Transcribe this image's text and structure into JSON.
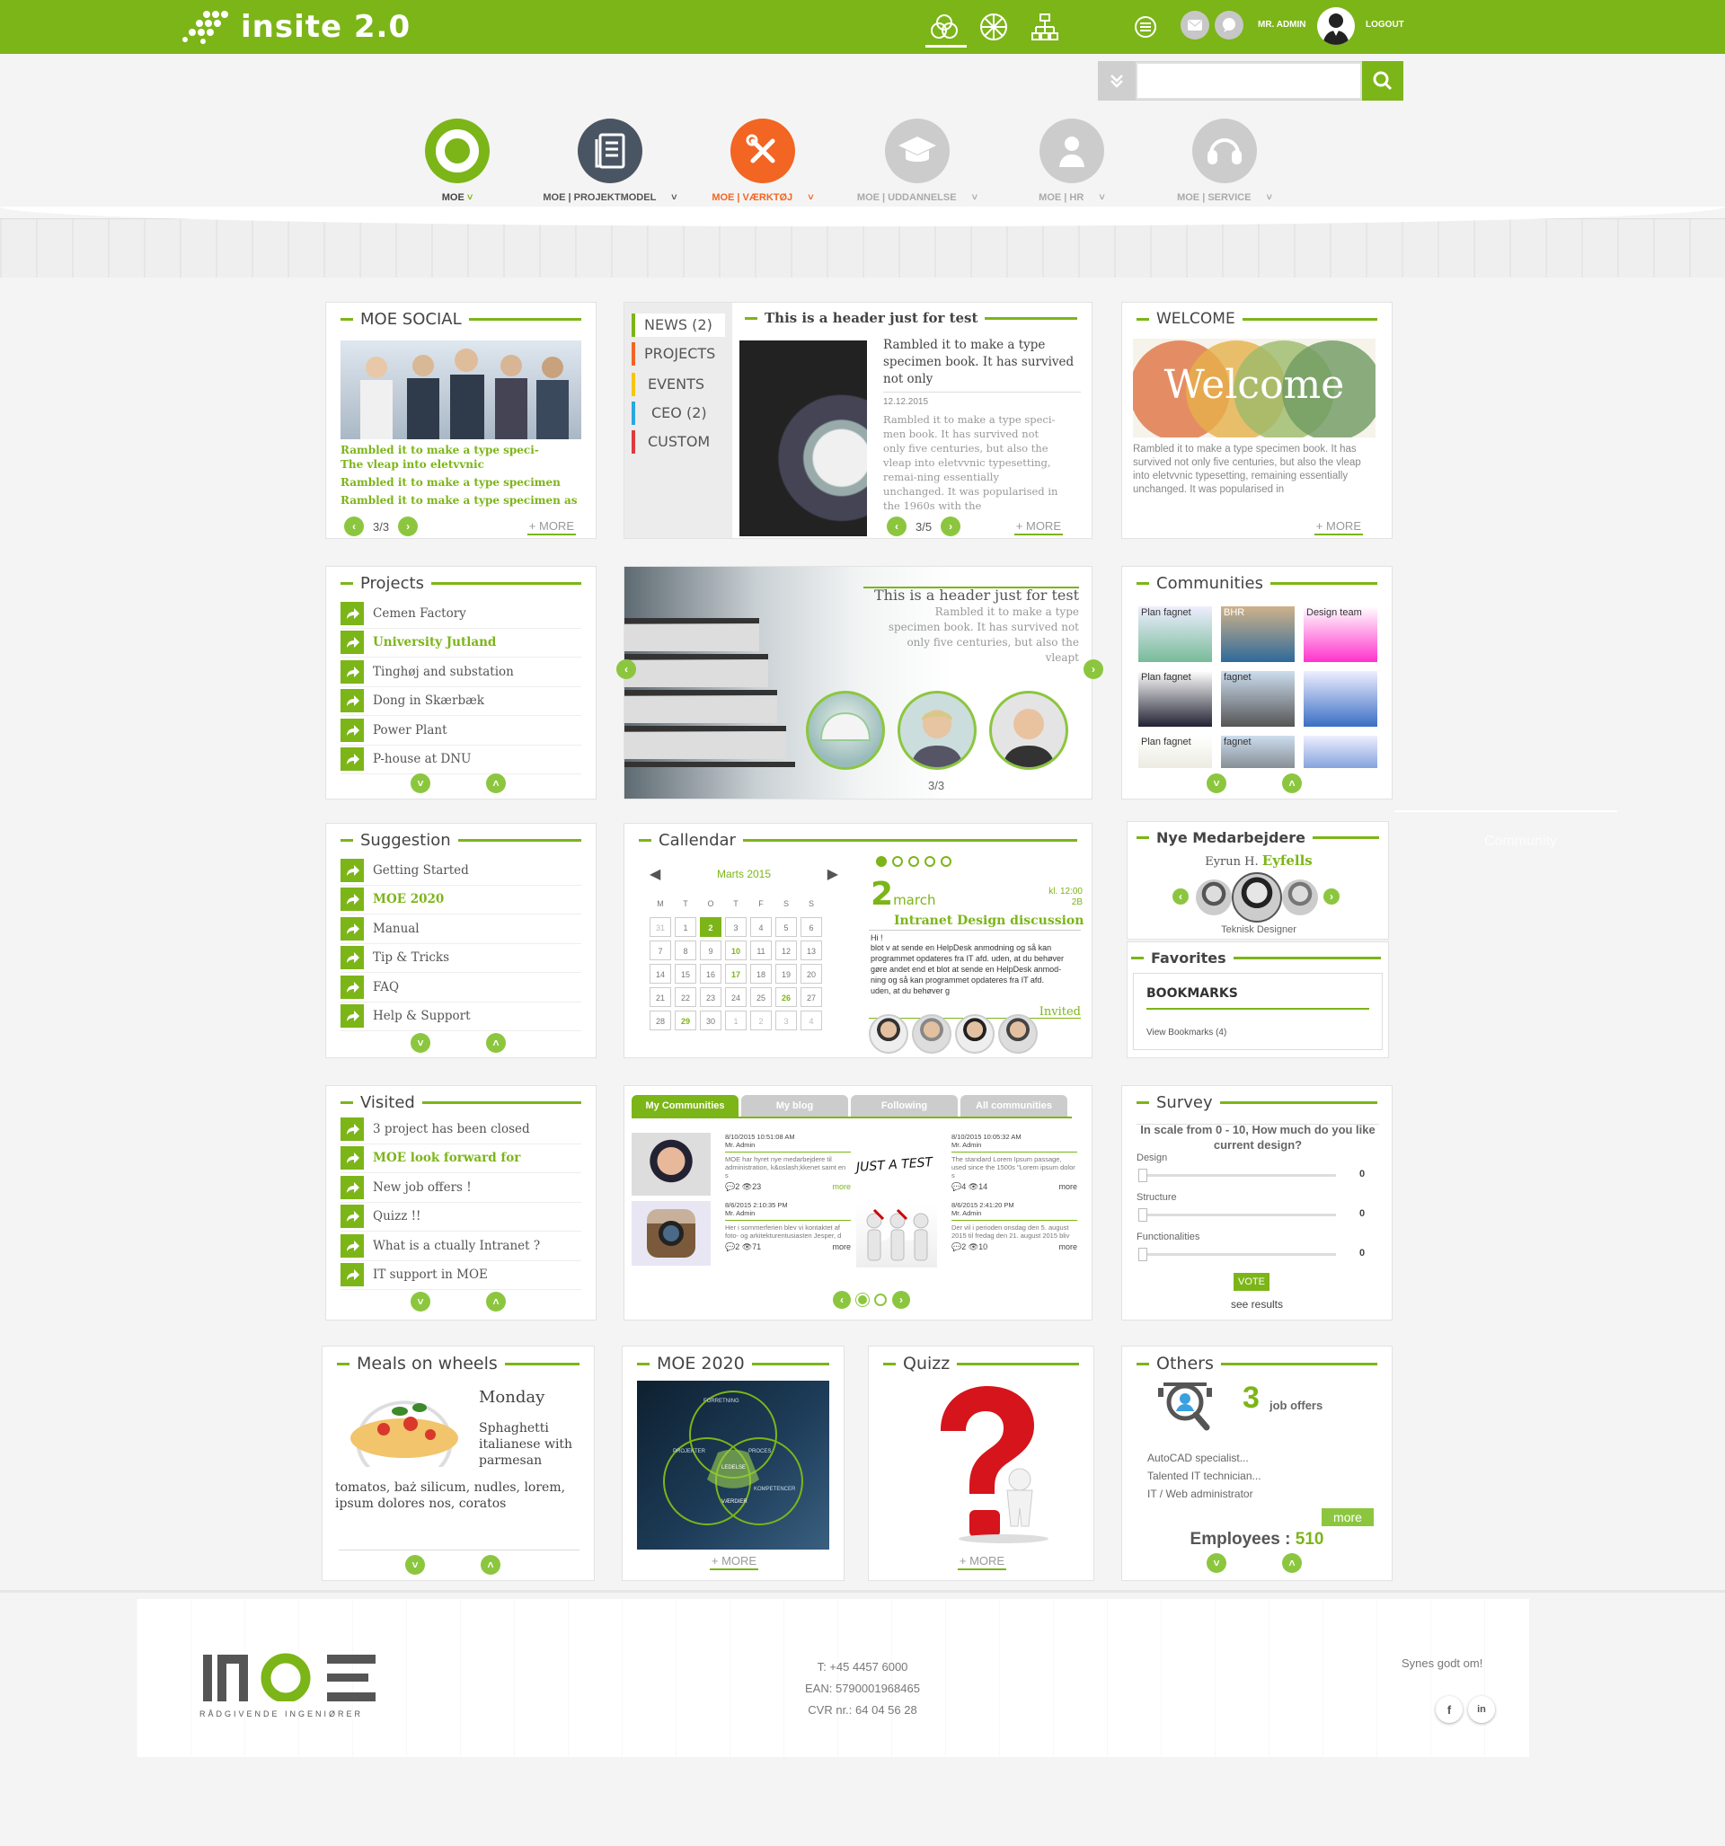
{
  "topbar": {
    "brand": "insite 2.0",
    "user": "MR. ADMIN",
    "logout": "LOGOUT",
    "icons": [
      "circles-icon",
      "wheel-icon",
      "sitemap-icon",
      "menu-icon",
      "mail-icon",
      "chat-icon"
    ]
  },
  "search": {
    "placeholder": ""
  },
  "nav": [
    {
      "label": "MOE",
      "icon": "ring-icon",
      "color": "#7cb518"
    },
    {
      "label": "MOE | PROJEKTMODEL",
      "icon": "document-icon",
      "color": "#4a5563"
    },
    {
      "label": "MOE | VÆRKTØJ",
      "icon": "tools-icon",
      "color": "#f26522"
    },
    {
      "label": "MOE | UDDANNELSE",
      "icon": "graduation-cap-icon",
      "color": "#cccccc"
    },
    {
      "label": "MOE | HR",
      "icon": "person-icon",
      "color": "#cccccc"
    },
    {
      "label": "MOE | SERVICE",
      "icon": "service-icon",
      "color": "#cccccc"
    }
  ],
  "social": {
    "title": "MOE SOCIAL",
    "lines": [
      "Rambled it to make a type speci-",
      "The vleap into eletvvnic",
      "Rambled it to make a type specimen",
      "Rambled it to make a type specimen  as"
    ],
    "pager": "3/3",
    "more": "+ MORE"
  },
  "news": {
    "tabs": [
      "NEWS (2)",
      "PROJECTS",
      "EVENTS",
      "CEO (2)",
      "CUSTOM"
    ],
    "tab_colors": [
      "#7cb518",
      "#f26522",
      "#f7c600",
      "#29a8e0",
      "#e03a3e"
    ],
    "header": "This is a header just for test",
    "headline": "Rambled it to make a type specimen book. It has survived not only",
    "date": "12.12.2015",
    "body": "Rambled it to make a type speci-men book. It has survived not only five centuries, but also the vleap into eletvvnic typesetting, remai-ning essentially unchanged. It was popularised in the 1960s with the",
    "pager": "3/5",
    "more": "+ MORE"
  },
  "welcome": {
    "title": "WELCOME",
    "image_text": "Welcome",
    "body": "Rambled it to make a type specimen book. It has survived not only five centuries, but also the vleap into eletvvnic typesetting, remaining essentially unchanged. It was popularised in",
    "more": "+ MORE"
  },
  "projects": {
    "title": "Projects",
    "items": [
      "Cemen Factory",
      "University Jutland",
      "Tinghøj and substation",
      "Dong in Skærbæk",
      "Power Plant",
      "P-house at DNU"
    ]
  },
  "slider": {
    "header": "This is a header just for test",
    "body": "Rambled it to make a type specimen book. It has survived not only five centuries, but also the vleapt",
    "pager": "3/3"
  },
  "communities": {
    "title": "Communities",
    "tiles": [
      "Plan fagnet",
      "BHR",
      "Design team",
      "Plan fagnet",
      "fagnet",
      "",
      "Plan fagnet",
      "fagnet",
      ""
    ],
    "ghost": "Community"
  },
  "suggestion": {
    "title": "Suggestion",
    "items": [
      "Getting Started",
      "MOE 2020",
      "Manual",
      "Tip & Tricks",
      "FAQ",
      "Help & Support"
    ]
  },
  "calendar": {
    "title": "Callendar",
    "month": "Marts 2015",
    "days": [
      "M",
      "T",
      "O",
      "T",
      "F",
      "S",
      "S"
    ],
    "weeks": [
      [
        "31",
        "1",
        "2",
        "3",
        "4",
        "5",
        "6"
      ],
      [
        "7",
        "8",
        "9",
        "10",
        "11",
        "12",
        "13"
      ],
      [
        "14",
        "15",
        "16",
        "17",
        "18",
        "19",
        "20"
      ],
      [
        "21",
        "22",
        "23",
        "24",
        "25",
        "26",
        "27"
      ],
      [
        "28",
        "29",
        "30",
        "1",
        "2",
        "3",
        "4"
      ]
    ],
    "event_day": "2",
    "event_month": "march",
    "time": "kl. 12:00",
    "room": "2B",
    "event_title": "Intranet Design discussion",
    "greeting": "Hi !",
    "event_body": "blot v at sende en HelpDesk anmodning og så kan programmet opdateres fra IT afd. uden, at du behøver gøre andet end et blot at sende en HelpDesk anmod-ning og så kan programmet opdateres fra IT afd. uden, at du behøver g",
    "invited": "Invited"
  },
  "nye": {
    "title": "Nye  Medarbejdere",
    "first": "Eyrun H.",
    "last": "Eyfells",
    "role": "Teknisk Designer"
  },
  "favorites": {
    "title": "Favorites",
    "bookmarks": "BOOKMARKS",
    "view": "View Bookmarks (4)"
  },
  "visited": {
    "title": "Visited",
    "items": [
      "3 project has been closed",
      "MOE look forward for",
      "New job offers !",
      "Quizz !!",
      "What is a ctually Intranet ?",
      "IT support in MOE"
    ]
  },
  "blog": {
    "tabs": [
      "My Communities",
      "My blog",
      "Following",
      "All communities"
    ],
    "posts": [
      {
        "date": "8/10/2015 10:51:08 AM",
        "author": "Mr. Admin",
        "text": "MOE har hyret nye medarbejdere til administration, k&oslash;kkenet samt en s",
        "comments": "2",
        "views": "23",
        "more": "more"
      },
      {
        "date": "8/10/2015 10:05:32 AM",
        "author": "Mr. Admin",
        "text": "The standard Lorem Ipsum passage, used since the 1500s \"Lorem ipsum dolor s",
        "comments": "4",
        "views": "14",
        "more": "more"
      },
      {
        "date": "8/6/2015 2:10:35 PM",
        "author": "Mr. Admin",
        "text": "Her i sommerferien blev vi kontaktet af foto- og arkitekturentusiasten Jesper, d",
        "comments": "2",
        "views": "71",
        "more": "more"
      },
      {
        "date": "8/6/2015 2:41:20 PM",
        "author": "Mr. Admin",
        "text": "Der vil i perioden onsdag den 5. august 2015 til fredag den 21. august 2015 bliv",
        "comments": "2",
        "views": "10",
        "more": "more"
      }
    ],
    "just_a_test": "JUST A TEST"
  },
  "survey": {
    "title": "Survey",
    "question": "In scale from 0 - 10, How much do you like current design?",
    "rows": [
      {
        "label": "Design",
        "value": "0"
      },
      {
        "label": "Structure",
        "value": "0"
      },
      {
        "label": "Functionalities",
        "value": "0"
      }
    ],
    "vote": "VOTE",
    "results": "see results"
  },
  "meals": {
    "title": "Meals on wheels",
    "day": "Monday",
    "dish": "Sphaghetti italianese with parmesan",
    "desc": "tomatos, baż silicum, nudles, lorem, ipsum dolores nos, coratos"
  },
  "moe2020": {
    "title": "MOE 2020",
    "more": "+ MORE",
    "diagram": [
      "FORRETNING",
      "PROJEKTER",
      "PROCES",
      "KOMPETENCER",
      "VÆRDIER",
      "LEDELSE"
    ]
  },
  "quizz": {
    "title": "Quizz",
    "more": "+ MORE"
  },
  "others": {
    "title": "Others",
    "count": "3",
    "count_label": "job offers",
    "jobs": [
      "AutoCAD specialist...",
      "Talented IT technician...",
      "IT / Web administrator"
    ],
    "more": "more",
    "employees_label": "Employees :",
    "employees": "510"
  },
  "footer": {
    "logo": "MOE",
    "logo_sub": "RÅDGIVENDE INGENIØRER",
    "phone": "T: +45 4457 6000",
    "ean": "EAN: 5790001968465",
    "cvr": "CVR nr.: 64 04 56 28",
    "synes": "Synes godt om!"
  }
}
